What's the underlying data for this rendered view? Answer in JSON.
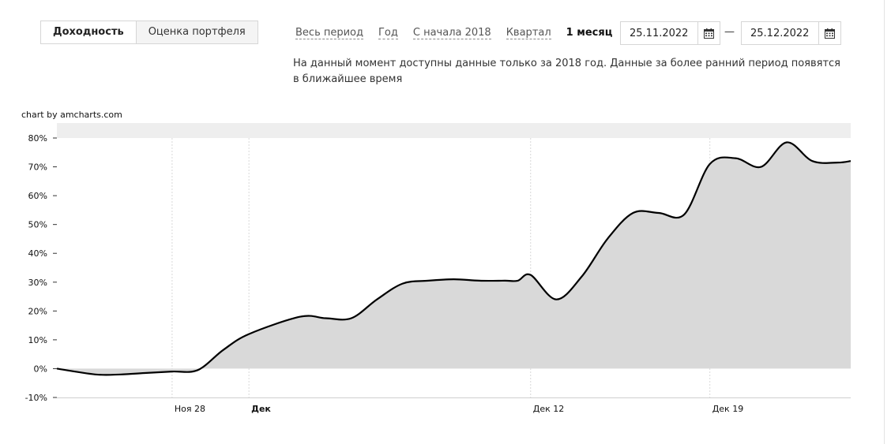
{
  "tabs": {
    "yield": "Доходность",
    "portfolio": "Оценка портфеля"
  },
  "periods": [
    "Весь период",
    "Год",
    "С начала 2018",
    "Квартал",
    "1 месяц"
  ],
  "active_period_index": 4,
  "date_range": {
    "from": "25.11.2022",
    "separator": "—",
    "to": "25.12.2022"
  },
  "note": "На данный момент доступны данные только за 2018 год. Данные за более ранний период появятся в ближайшее время",
  "credit": "chart by amcharts.com",
  "icons": {
    "calendar": "calendar-icon"
  },
  "chart_data": {
    "type": "area",
    "y_unit": "%",
    "ylim": [
      -10,
      80
    ],
    "y_ticks": [
      -10,
      0,
      10,
      20,
      30,
      40,
      50,
      60,
      70,
      80
    ],
    "x_ticks": [
      {
        "label": "Ноя 28",
        "date": "2022-11-28",
        "bold": false
      },
      {
        "label": "Дек",
        "date": "2022-12-01",
        "bold": true
      },
      {
        "label": "Дек 12",
        "date": "2022-12-12",
        "bold": false
      },
      {
        "label": "Дек 19",
        "date": "2022-12-19",
        "bold": false
      }
    ],
    "x_range": [
      "2022-11-23 12:00",
      "2022-12-24 12:00"
    ],
    "series": [
      {
        "fill_color": "#d9d9d9",
        "line_color": "#000000",
        "points": [
          [
            "2022-11-23 12:00",
            0.0
          ],
          [
            "2022-11-25",
            -2.0
          ],
          [
            "2022-11-26",
            -2.0
          ],
          [
            "2022-11-27",
            -1.5
          ],
          [
            "2022-11-28",
            -1.0
          ],
          [
            "2022-11-29",
            -0.5
          ],
          [
            "2022-11-30",
            6.5
          ],
          [
            "2022-12-01",
            12.0
          ],
          [
            "2022-12-03",
            18.0
          ],
          [
            "2022-12-04",
            17.5
          ],
          [
            "2022-12-05",
            17.5
          ],
          [
            "2022-12-06",
            24.0
          ],
          [
            "2022-12-07",
            29.5
          ],
          [
            "2022-12-08",
            30.5
          ],
          [
            "2022-12-09",
            31.0
          ],
          [
            "2022-12-10",
            30.5
          ],
          [
            "2022-12-11",
            30.5
          ],
          [
            "2022-12-11 12:00",
            30.5
          ],
          [
            "2022-12-12",
            32.5
          ],
          [
            "2022-12-13",
            24.0
          ],
          [
            "2022-12-14",
            32.0
          ],
          [
            "2022-12-15",
            45.0
          ],
          [
            "2022-12-16",
            54.0
          ],
          [
            "2022-12-17",
            54.0
          ],
          [
            "2022-12-18",
            53.5
          ],
          [
            "2022-12-19",
            71.0
          ],
          [
            "2022-12-20",
            73.0
          ],
          [
            "2022-12-21",
            70.0
          ],
          [
            "2022-12-22",
            78.5
          ],
          [
            "2022-12-23",
            72.0
          ],
          [
            "2022-12-24",
            71.5
          ],
          [
            "2022-12-24 12:00",
            72.0
          ]
        ]
      }
    ],
    "grid": true
  }
}
